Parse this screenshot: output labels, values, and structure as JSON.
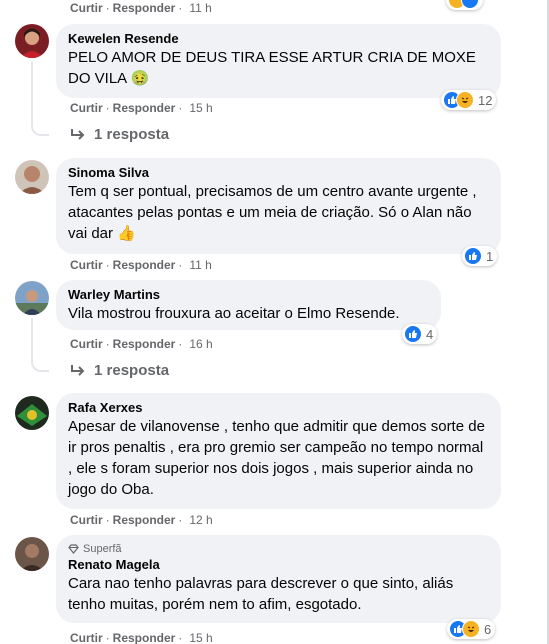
{
  "actions": {
    "like_label": "Curtir",
    "reply_label": "Responder",
    "separator": "·"
  },
  "comments": [
    {
      "time": "11 h"
    },
    {
      "author": "Kewelen Resende",
      "text": "PELO AMOR DE DEUS TIRA ESSE ARTUR CRIA DE MOXE DO VILA 🤢",
      "time": "15 h",
      "reactions": {
        "count": "12",
        "types": [
          "like-icon",
          "haha-icon"
        ]
      },
      "replies": "1 resposta"
    },
    {
      "author": "Sinoma Silva",
      "text": "Tem q ser pontual, precisamos de um centro avante urgente , atacantes pelas pontas e um meia de criação. Só o Alan não vai dar 👍",
      "time": "11 h",
      "reactions": {
        "count": "1",
        "types": [
          "like-icon"
        ]
      }
    },
    {
      "author": "Warley Martins",
      "text": "Vila mostrou frouxura ao aceitar o Elmo Resende.",
      "time": "16 h",
      "reactions": {
        "count": "4",
        "types": [
          "like-icon"
        ]
      },
      "replies": "1 resposta"
    },
    {
      "author": "Rafa Xerxes",
      "text": "Apesar de vilanovense , tenho que admitir que demos sorte de ir pros penaltis , era pro gremio ser campeão no tempo normal , ele s foram superior nos dois jogos , mais superior ainda no jogo do Oba.",
      "time": "12 h"
    },
    {
      "badge": "Superfã",
      "author": "Renato Magela",
      "text": "Cara nao tenho palavras para descrever o que sinto, aliás tenho muitas, porém nem to afim, esgotado.",
      "time": "15 h",
      "reactions": {
        "count": "6",
        "types": [
          "like-icon",
          "haha-icon"
        ]
      }
    }
  ]
}
